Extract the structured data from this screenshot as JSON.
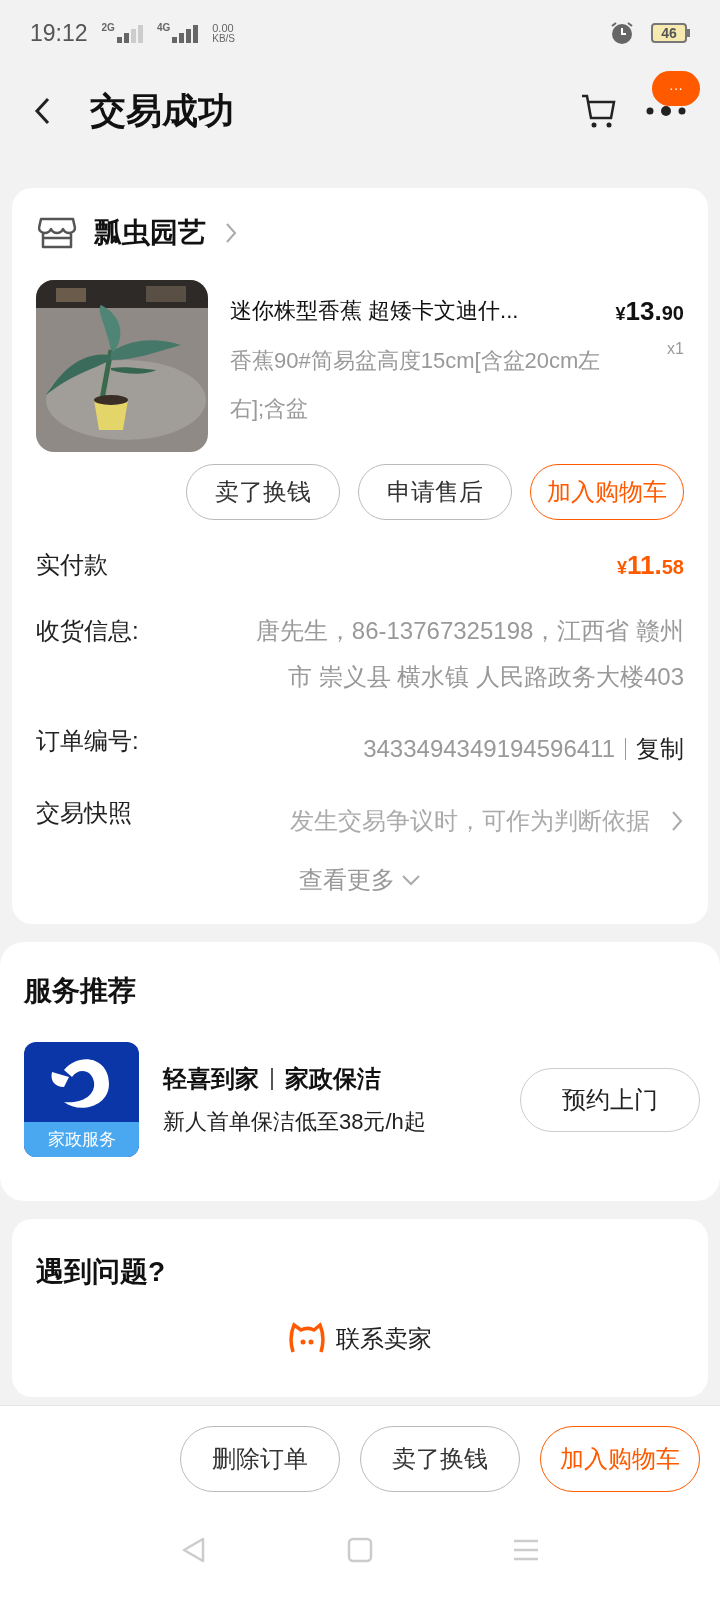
{
  "status_bar": {
    "time": "19:12",
    "sim1": "2G",
    "sim2": "4G",
    "speed": "0.00",
    "speed_unit": "KB/S",
    "battery": "46"
  },
  "header": {
    "title": "交易成功",
    "badge": "···"
  },
  "order": {
    "shop": "瓢虫园艺",
    "product": {
      "title": "迷你株型香蕉 超矮卡文迪什...",
      "spec": "香蕉90#简易盆高度15cm[含盆20cm左右];含盆",
      "price": {
        "currency": "¥",
        "integer": "13.",
        "decimal": "90"
      },
      "quantity": "x1"
    },
    "actions": [
      {
        "label": "卖了换钱",
        "highlighted": false
      },
      {
        "label": "申请售后",
        "highlighted": false
      },
      {
        "label": "加入购物车",
        "highlighted": true
      }
    ],
    "paid": {
      "label": "实付款",
      "currency": "¥",
      "integer": "11.",
      "decimal": "58"
    },
    "details": [
      {
        "kind": "address",
        "label": "收货信息:",
        "value": "唐先生，86-13767325198，江西省 赣州市 崇义县 横水镇 人民路政务大楼403"
      },
      {
        "kind": "order",
        "label": "订单编号:",
        "value": "3433494349194596411",
        "action": "复制"
      },
      {
        "kind": "link",
        "label": "交易快照",
        "value": "发生交易争议时，可作为判断依据"
      }
    ],
    "more": "查看更多"
  },
  "services": {
    "title": "服务推荐",
    "items": [
      {
        "icon_label": "家政服务",
        "brand": "轻喜到家",
        "category": "家政保洁",
        "description": "新人首单保洁低至38元/h起",
        "button": "预约上门"
      }
    ]
  },
  "help": {
    "title": "遇到问题?",
    "contact": "联系卖家"
  },
  "bottom_actions": [
    {
      "label": "删除订单",
      "highlighted": false
    },
    {
      "label": "卖了换钱",
      "highlighted": false
    },
    {
      "label": "加入购物车",
      "highlighted": true
    }
  ]
}
